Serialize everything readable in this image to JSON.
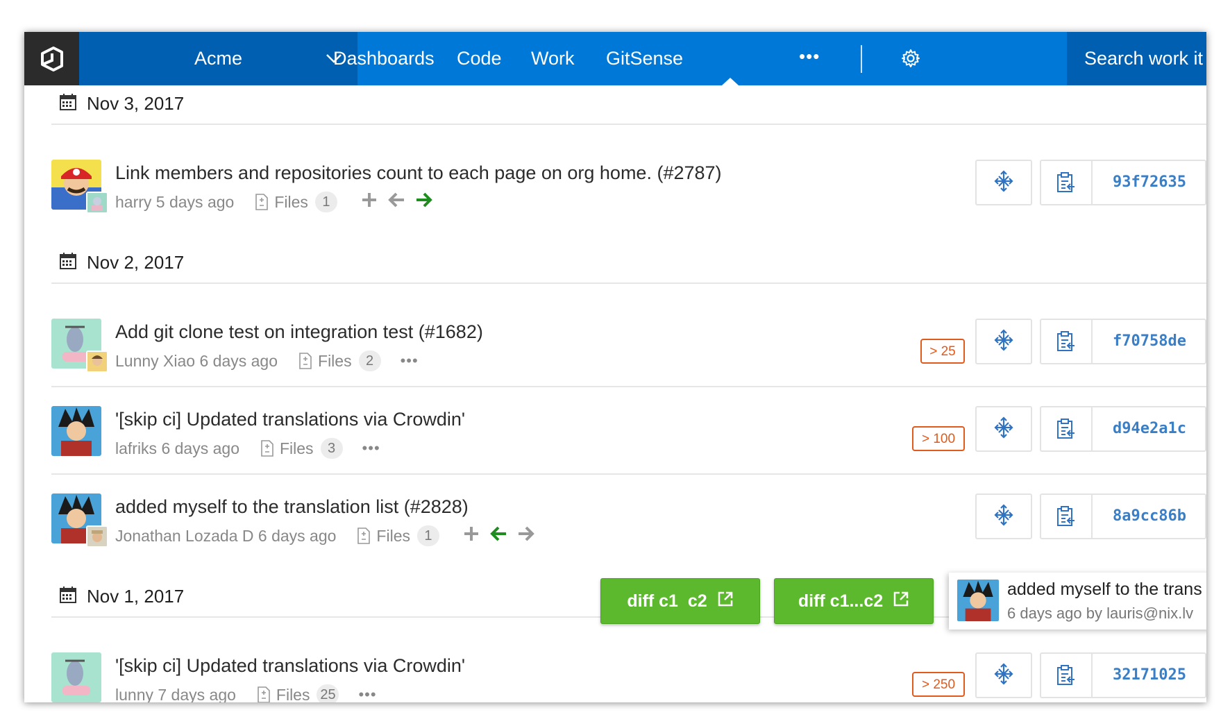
{
  "nav": {
    "project": "Acme",
    "items": [
      "Dashboards",
      "Code",
      "Work",
      "GitSense"
    ],
    "more": "•••",
    "search_placeholder": "Search work it"
  },
  "groups": [
    {
      "date": "Nov 3, 2017",
      "commits": [
        {
          "title": "Link members and repositories count to each page on org home. (#2787)",
          "author": "harry",
          "when": "5 days ago",
          "files_label": "Files",
          "files_count": "1",
          "sha": "93f72635",
          "actions": [
            "plus-icon",
            "arrow-left-icon",
            "arrow-right-icon"
          ]
        }
      ]
    },
    {
      "date": "Nov 2, 2017",
      "commits": [
        {
          "title": "Add git clone test on integration test (#1682)",
          "author": "Lunny Xiao",
          "when": "6 days ago",
          "files_label": "Files",
          "files_count": "2",
          "more": "•••",
          "badge": "> 25",
          "sha": "f70758de"
        },
        {
          "title": "'[skip ci] Updated translations via Crowdin'",
          "author": "lafriks",
          "when": "6 days ago",
          "files_label": "Files",
          "files_count": "3",
          "more": "•••",
          "badge": "> 100",
          "sha": "d94e2a1c"
        },
        {
          "title": "added myself to the translation list (#2828)",
          "author": "Jonathan Lozada D",
          "when": "6 days ago",
          "files_label": "Files",
          "files_count": "1",
          "sha": "8a9cc86b",
          "actions": [
            "plus-icon",
            "arrow-left-icon",
            "arrow-right-icon"
          ]
        }
      ]
    },
    {
      "date": "Nov 1, 2017",
      "commits": [
        {
          "title": "'[skip ci] Updated translations via Crowdin'",
          "author": "lunny",
          "when": "7 days ago",
          "files_label": "Files",
          "files_count": "25",
          "more": "•••",
          "badge": "> 250",
          "sha": "32171025"
        }
      ]
    }
  ],
  "popup": {
    "diff_button_1": "diff c1  c2",
    "diff_button_2": "diff c1...c2",
    "tooltip_title": "added myself to the trans",
    "tooltip_subtitle": "6 days ago by lauris@nix.lv"
  },
  "colors": {
    "nav_blue": "#0078d7",
    "nav_dark": "#005fb0",
    "logo_bg": "#2b2b2b",
    "sha_blue": "#3a7ec6",
    "badge_orange": "#e05a1c",
    "diff_green": "#5cb82c",
    "arrow_active_green": "#1e8c1e"
  }
}
